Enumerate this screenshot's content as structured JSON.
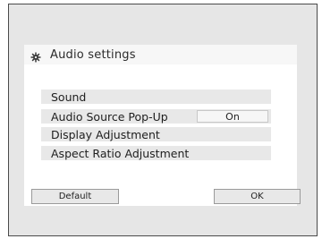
{
  "window": {
    "title": "Audio settings",
    "icon": "gear-icon"
  },
  "menu": {
    "items": [
      {
        "label": "Sound"
      },
      {
        "label": "Audio Source Pop-Up",
        "value": "On"
      },
      {
        "label": "Display Adjustment"
      },
      {
        "label": "Aspect Ratio Adjustment"
      }
    ]
  },
  "buttons": {
    "default_label": "Default",
    "ok_label": "OK"
  }
}
